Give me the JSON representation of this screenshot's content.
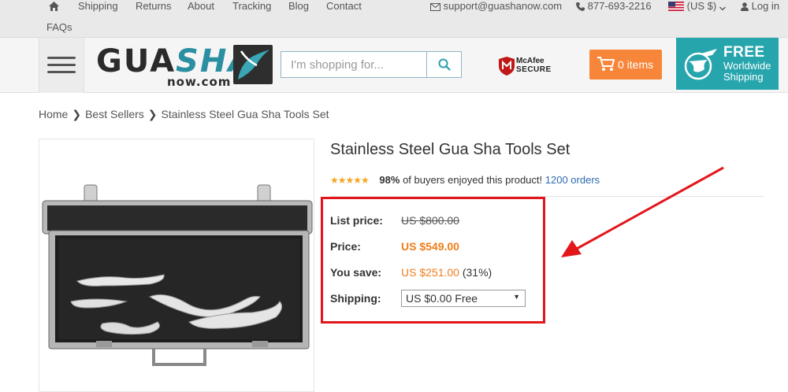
{
  "topbar": {
    "nav": [
      "Shipping",
      "Returns",
      "About",
      "Tracking",
      "Blog",
      "Contact",
      "FAQs"
    ],
    "email": "support@guashanow.com",
    "phone": "877-693-2216",
    "currency": "(US $)",
    "login": "Log in"
  },
  "header": {
    "logo_line1_a": "GUA",
    "logo_line1_b": "SHA",
    "logo_line2": "now.com",
    "search_placeholder": "I'm shopping for...",
    "mcafee_brand": "McAfee",
    "mcafee_secure": "SECURE",
    "cart_label": "0 items",
    "shipping_banner": {
      "line1": "FREE",
      "line2": "Worldwide",
      "line3": "Shipping"
    }
  },
  "breadcrumb": [
    "Home",
    "Best Sellers",
    "Stainless Steel Gua Sha Tools Set"
  ],
  "product": {
    "title": "Stainless Steel Gua Sha Tools Set",
    "rating_stars": 4.5,
    "buyers_percent": "98%",
    "buyers_text": "of buyers enjoyed this product!",
    "orders": "1200 orders",
    "list_price_label": "List price:",
    "list_price": "US $800.00",
    "price_label": "Price:",
    "price": "US $549.00",
    "save_label": "You save:",
    "save_amount": "US $251.00",
    "save_percent": "(31%)",
    "shipping_label": "Shipping:",
    "shipping_value": "US $0.00 Free"
  },
  "colors": {
    "accent_orange": "#f07d1a",
    "cart_orange": "#f7863a",
    "banner_teal": "#26a5ad",
    "annotation_red": "#e2161b",
    "link_blue": "#2b6cb0"
  }
}
